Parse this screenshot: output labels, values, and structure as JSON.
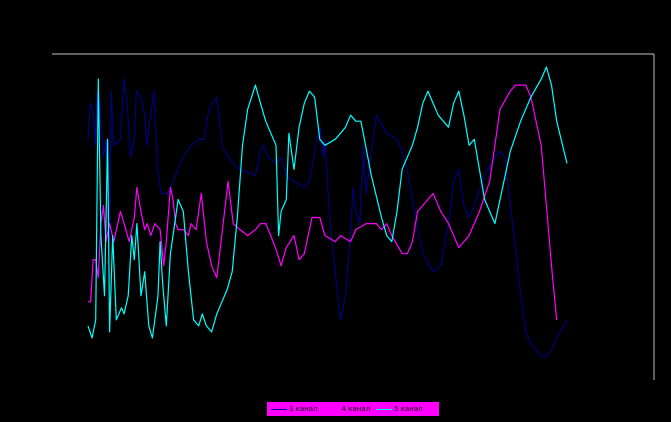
{
  "chart_data": {
    "type": "line",
    "title": "",
    "xlabel": "",
    "ylabel": "",
    "xlim": [
      0,
      100
    ],
    "ylim": [
      0,
      100
    ],
    "grid": false,
    "legend_position": "bottom",
    "background": "#000000",
    "frame_color": "#c0c0c0",
    "series": [
      {
        "name": "3 канал",
        "color": "#000080",
        "points": [
          [
            0,
            72
          ],
          [
            0.5,
            84
          ],
          [
            1,
            82
          ],
          [
            1.4,
            70
          ],
          [
            1.8,
            88
          ],
          [
            2.3,
            84
          ],
          [
            3,
            66
          ],
          [
            3.5,
            72
          ],
          [
            4.2,
            38
          ],
          [
            4.5,
            88
          ],
          [
            5,
            70
          ],
          [
            6.3,
            72
          ],
          [
            7,
            92
          ],
          [
            7.5,
            86
          ],
          [
            8.3,
            66
          ],
          [
            9,
            72
          ],
          [
            9.4,
            88
          ],
          [
            10.3,
            86
          ],
          [
            11,
            80
          ],
          [
            11.4,
            70
          ],
          [
            12,
            78
          ],
          [
            12.8,
            88
          ],
          [
            13.5,
            62
          ],
          [
            14.2,
            54
          ],
          [
            15.5,
            54
          ],
          [
            17,
            60
          ],
          [
            18.5,
            66
          ],
          [
            20,
            70
          ],
          [
            21.5,
            72
          ],
          [
            22.5,
            72
          ],
          [
            23.5,
            82
          ],
          [
            25,
            86
          ],
          [
            26,
            70
          ],
          [
            27.2,
            66
          ],
          [
            28.2,
            64
          ],
          [
            29.5,
            62
          ],
          [
            31,
            61
          ],
          [
            32.5,
            60
          ],
          [
            33.5,
            68
          ],
          [
            34,
            70
          ],
          [
            35,
            66
          ],
          [
            36.5,
            64
          ],
          [
            37.5,
            66
          ],
          [
            38.5,
            60
          ],
          [
            40,
            58
          ],
          [
            42,
            56
          ],
          [
            43,
            58
          ],
          [
            44.5,
            72
          ],
          [
            45,
            76
          ],
          [
            45.7,
            66
          ],
          [
            46,
            72
          ],
          [
            47,
            44
          ],
          [
            49,
            12
          ],
          [
            50,
            20
          ],
          [
            51,
            42
          ],
          [
            51.5,
            56
          ],
          [
            52,
            48
          ],
          [
            52.8,
            44
          ],
          [
            53.5,
            70
          ],
          [
            54,
            54
          ],
          [
            55,
            68
          ],
          [
            56,
            80
          ],
          [
            58,
            74
          ],
          [
            60,
            72
          ],
          [
            61,
            68
          ],
          [
            62,
            62
          ],
          [
            63,
            52
          ],
          [
            65,
            34
          ],
          [
            67,
            28
          ],
          [
            68.5,
            30
          ],
          [
            70,
            44
          ],
          [
            71,
            58
          ],
          [
            72,
            62
          ],
          [
            73,
            50
          ],
          [
            74,
            46
          ],
          [
            75,
            50
          ],
          [
            77,
            60
          ],
          [
            79,
            66
          ],
          [
            80,
            68
          ],
          [
            81,
            66
          ],
          [
            82,
            50
          ],
          [
            83,
            36
          ],
          [
            84,
            20
          ],
          [
            85,
            8
          ],
          [
            86,
            4
          ],
          [
            87,
            2
          ],
          [
            88,
            0
          ],
          [
            89,
            0
          ],
          [
            90,
            2
          ],
          [
            91,
            6
          ],
          [
            93,
            12
          ]
        ]
      },
      {
        "name": "4 канал",
        "color": "#ff00ff",
        "points": [
          [
            0,
            18
          ],
          [
            0.5,
            18
          ],
          [
            1,
            32
          ],
          [
            1.5,
            32
          ],
          [
            2,
            26
          ],
          [
            2.5,
            44
          ],
          [
            3,
            50
          ],
          [
            3.5,
            38
          ],
          [
            4.2,
            44
          ],
          [
            5,
            38
          ],
          [
            6.3,
            48
          ],
          [
            7,
            44
          ],
          [
            8,
            38
          ],
          [
            9,
            46
          ],
          [
            9.5,
            56
          ],
          [
            10.3,
            48
          ],
          [
            11,
            42
          ],
          [
            11.5,
            44
          ],
          [
            12.2,
            40
          ],
          [
            13,
            44
          ],
          [
            14,
            42
          ],
          [
            14.7,
            30
          ],
          [
            15.2,
            38
          ],
          [
            16,
            56
          ],
          [
            16.5,
            52
          ],
          [
            17,
            44
          ],
          [
            17.5,
            42
          ],
          [
            18.5,
            42
          ],
          [
            19.5,
            40
          ],
          [
            20,
            44
          ],
          [
            21,
            42
          ],
          [
            22,
            54
          ],
          [
            23,
            38
          ],
          [
            24,
            30
          ],
          [
            25,
            26
          ],
          [
            27.2,
            58
          ],
          [
            28.2,
            44
          ],
          [
            29.5,
            42
          ],
          [
            31,
            40
          ],
          [
            32.5,
            42
          ],
          [
            33.5,
            44
          ],
          [
            34.5,
            44
          ],
          [
            35.5,
            40
          ],
          [
            36.8,
            34
          ],
          [
            37.5,
            30
          ],
          [
            38.5,
            36
          ],
          [
            40,
            40
          ],
          [
            41,
            32
          ],
          [
            42,
            34
          ],
          [
            43.5,
            46
          ],
          [
            45,
            46
          ],
          [
            46,
            40
          ],
          [
            48,
            38
          ],
          [
            49,
            40
          ],
          [
            51,
            38
          ],
          [
            52,
            42
          ],
          [
            54,
            44
          ],
          [
            56,
            44
          ],
          [
            57,
            42
          ],
          [
            58,
            44
          ],
          [
            59,
            40
          ],
          [
            61,
            34
          ],
          [
            62,
            34
          ],
          [
            63,
            38
          ],
          [
            64,
            48
          ],
          [
            66,
            52
          ],
          [
            67,
            54
          ],
          [
            68.5,
            48
          ],
          [
            70,
            44
          ],
          [
            72,
            36
          ],
          [
            74,
            40
          ],
          [
            76,
            48
          ],
          [
            78,
            58
          ],
          [
            79,
            70
          ],
          [
            80,
            82
          ],
          [
            82,
            88
          ],
          [
            83,
            90
          ],
          [
            85,
            90
          ],
          [
            86,
            86
          ],
          [
            88,
            70
          ],
          [
            89,
            50
          ],
          [
            90,
            30
          ],
          [
            91,
            12
          ]
        ]
      },
      {
        "name": "5 канал",
        "color": "#00ffff",
        "points": [
          [
            0,
            10
          ],
          [
            0.8,
            6
          ],
          [
            1.5,
            12
          ],
          [
            2,
            92
          ],
          [
            2.5,
            40
          ],
          [
            3.2,
            20
          ],
          [
            3.8,
            72
          ],
          [
            4.2,
            8
          ],
          [
            4.8,
            40
          ],
          [
            5.5,
            12
          ],
          [
            6.5,
            16
          ],
          [
            7,
            14
          ],
          [
            7.8,
            20
          ],
          [
            8.5,
            40
          ],
          [
            9,
            32
          ],
          [
            9.5,
            44
          ],
          [
            10.3,
            20
          ],
          [
            11,
            28
          ],
          [
            11.8,
            10
          ],
          [
            12.5,
            6
          ],
          [
            13.6,
            20
          ],
          [
            14,
            38
          ],
          [
            14.5,
            24
          ],
          [
            15.2,
            10
          ],
          [
            16,
            34
          ],
          [
            16.5,
            40
          ],
          [
            17.5,
            52
          ],
          [
            18.5,
            48
          ],
          [
            19.5,
            28
          ],
          [
            20.5,
            12
          ],
          [
            21.5,
            10
          ],
          [
            22.2,
            14
          ],
          [
            23,
            10
          ],
          [
            24,
            8
          ],
          [
            25,
            14
          ],
          [
            26,
            18
          ],
          [
            27,
            22
          ],
          [
            28,
            28
          ],
          [
            29,
            46
          ],
          [
            30,
            70
          ],
          [
            31,
            82
          ],
          [
            32.5,
            90
          ],
          [
            33.5,
            84
          ],
          [
            34.5,
            78
          ],
          [
            36.5,
            70
          ],
          [
            37,
            40
          ],
          [
            37.5,
            48
          ],
          [
            38.5,
            52
          ],
          [
            39,
            74
          ],
          [
            40,
            62
          ],
          [
            41,
            76
          ],
          [
            42,
            84
          ],
          [
            43,
            88
          ],
          [
            44,
            86
          ],
          [
            45,
            72
          ],
          [
            46,
            70
          ],
          [
            48,
            72
          ],
          [
            49,
            74
          ],
          [
            50,
            76
          ],
          [
            51,
            80
          ],
          [
            52,
            78
          ],
          [
            53,
            78
          ],
          [
            55,
            60
          ],
          [
            57,
            46
          ],
          [
            58,
            40
          ],
          [
            59,
            38
          ],
          [
            60,
            48
          ],
          [
            61,
            62
          ],
          [
            63,
            70
          ],
          [
            64,
            76
          ],
          [
            65,
            84
          ],
          [
            66,
            88
          ],
          [
            68,
            80
          ],
          [
            70,
            76
          ],
          [
            71,
            84
          ],
          [
            72,
            88
          ],
          [
            73,
            80
          ],
          [
            74,
            70
          ],
          [
            75,
            72
          ],
          [
            77,
            52
          ],
          [
            79,
            44
          ],
          [
            81,
            60
          ],
          [
            82,
            68
          ],
          [
            84,
            78
          ],
          [
            86,
            86
          ],
          [
            88,
            92
          ],
          [
            89,
            96
          ],
          [
            90,
            90
          ],
          [
            91,
            78
          ],
          [
            93,
            64
          ]
        ]
      }
    ]
  },
  "legend": {
    "background": "#ff00ff",
    "items": [
      {
        "label": "3 канал",
        "color": "#000080"
      },
      {
        "label": "4 канал",
        "color": "#ff00ff"
      },
      {
        "label": "5 канал",
        "color": "#00ffff"
      }
    ]
  }
}
